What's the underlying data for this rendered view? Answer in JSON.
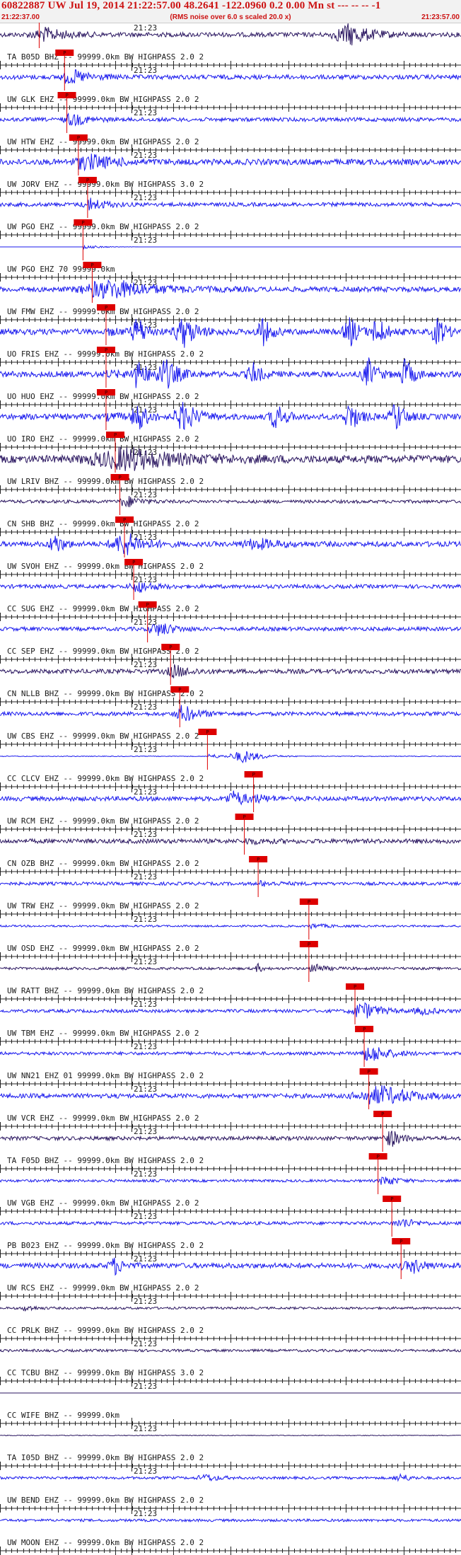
{
  "header": {
    "title": "60822887 UW Jul 19, 2014 21:22:57.00   48.2641 -122.0960  0.2 0.00 Mn st --- -- --  -1",
    "start_time": "21:22:37.00",
    "note": "(RMS noise over 6.0 s scaled 20.0 x)",
    "end_time": "21:23:57.00"
  },
  "minute_label": "21:23",
  "pick_label": "P",
  "colors": {
    "trace_blue": "#1a1aee",
    "trace_navy": "#2a1660",
    "pick_red": "#dd0000",
    "grid": "#222222"
  },
  "traces": [
    {
      "label": "TA B05D BHZ -- 99999.0km BW  HIGHPASS  2.0  2",
      "color": "navy",
      "pick": 0.085,
      "amp": 0.35,
      "bursts": [
        [
          0.1,
          0.05,
          0.7
        ],
        [
          0.76,
          0.05,
          1.6
        ]
      ]
    },
    {
      "label": "UW GLK EHZ -- 99999.0km BW  HIGHPASS  2.0  2",
      "color": "blue",
      "pick": 0.14,
      "amp": 0.35,
      "bursts": [
        [
          0.16,
          0.04,
          0.7
        ]
      ]
    },
    {
      "label": "UW HTW EHZ -- 99999.0km BW  HIGHPASS  2.0  2",
      "color": "blue",
      "pick": 0.145,
      "amp": 0.3,
      "bursts": [
        [
          0.16,
          0.03,
          0.6
        ]
      ]
    },
    {
      "label": "UW JORV EHZ -- 99999.0km BW  HIGHPASS  3.0  2",
      "color": "blue",
      "pick": 0.17,
      "amp": 0.45,
      "bursts": [
        [
          0.2,
          0.06,
          0.8
        ]
      ]
    },
    {
      "label": "UW PGO EHZ -- 99999.0km BW  HIGHPASS  2.0  2",
      "color": "blue",
      "pick": 0.19,
      "amp": 0.3,
      "bursts": [
        [
          0.2,
          0.03,
          0.6
        ]
      ]
    },
    {
      "label": "UW PGO EHZ 70 99999.0km",
      "color": "blue",
      "pick": 0.18,
      "amp": 0.0,
      "bursts": []
    },
    {
      "label": "UW FMW EHZ -- 99999.0km BW  HIGHPASS  2.0  2",
      "color": "blue",
      "pick": 0.2,
      "amp": 0.4,
      "bursts": [
        [
          0.25,
          0.1,
          1.2
        ]
      ]
    },
    {
      "label": "UO FRIS EHZ -- 99999.0km BW  HIGHPASS  2.0  2",
      "color": "blue",
      "pick": 0.23,
      "amp": 0.45,
      "bursts": [
        [
          0.3,
          0.02,
          2.2
        ],
        [
          0.4,
          0.03,
          2.2
        ],
        [
          0.57,
          0.02,
          2
        ],
        [
          0.76,
          0.02,
          2.2
        ],
        [
          0.82,
          0.02,
          2.2
        ],
        [
          0.95,
          0.02,
          2
        ]
      ]
    },
    {
      "label": "UO HUO EHZ -- 99999.0km BW  HIGHPASS  2.0  2",
      "color": "blue",
      "pick": 0.23,
      "amp": 0.45,
      "bursts": [
        [
          0.3,
          0.02,
          2.2
        ],
        [
          0.36,
          0.03,
          2.2
        ],
        [
          0.55,
          0.02,
          1.5
        ],
        [
          0.8,
          0.02,
          2.2
        ],
        [
          0.88,
          0.02,
          2.2
        ]
      ]
    },
    {
      "label": "UO IRO EHZ -- 99999.0km BW  HIGHPASS  2.0  2",
      "color": "blue",
      "pick": 0.23,
      "amp": 0.45,
      "bursts": [
        [
          0.3,
          0.02,
          2.2
        ],
        [
          0.4,
          0.03,
          2.2
        ],
        [
          0.6,
          0.02,
          2
        ],
        [
          0.76,
          0.02,
          2.2
        ],
        [
          0.86,
          0.02,
          2.2
        ]
      ]
    },
    {
      "label": "UW LRIV BHZ -- 99999.0km BW  HIGHPASS  2.0  2",
      "color": "navy",
      "pick": 0.25,
      "amp": 0.6,
      "bursts": [
        [
          0.28,
          0.12,
          1.4
        ]
      ]
    },
    {
      "label": "CN SHB BHZ -- 99999.0km BW  HIGHPASS  2.0  2",
      "color": "navy",
      "pick": 0.26,
      "amp": 0.25,
      "bursts": [
        [
          0.28,
          0.03,
          0.5
        ]
      ]
    },
    {
      "label": "UW SVOH EHZ -- 99999.0km BW  HIGHPASS  2.0  2",
      "color": "blue",
      "pick": 0.27,
      "amp": 0.4,
      "bursts": [
        [
          0.12,
          0.02,
          1.4
        ],
        [
          0.27,
          0.04,
          1.6
        ],
        [
          0.56,
          0.05,
          0.7
        ]
      ]
    },
    {
      "label": "CC SUG EHZ -- 99999.0km BW  HIGHPASS  2.0  2",
      "color": "blue",
      "pick": 0.29,
      "amp": 0.3,
      "bursts": [
        [
          0.3,
          0.03,
          0.6
        ]
      ]
    },
    {
      "label": "CC SEP EHZ -- 99999.0km BW  HIGHPASS  2.0  2",
      "color": "blue",
      "pick": 0.32,
      "amp": 0.3,
      "bursts": [
        [
          0.35,
          0.03,
          0.8
        ]
      ]
    },
    {
      "label": "CN NLLB BHZ -- 99999.0km BW  HIGHPASS  2.0  2",
      "color": "navy",
      "pick": 0.37,
      "amp": 0.35,
      "bursts": [
        [
          0.38,
          0.03,
          0.6
        ]
      ]
    },
    {
      "label": "UW CBS EHZ -- 99999.0km BW  HIGHPASS  2.0  2",
      "color": "blue",
      "pick": 0.39,
      "amp": 0.3,
      "bursts": [
        [
          0.4,
          0.03,
          1.0
        ]
      ]
    },
    {
      "label": "CC CLCV EHZ -- 99999.0km BW  HIGHPASS  2.0  2",
      "color": "blue",
      "pick": 0.45,
      "amp": 0.06,
      "bursts": [
        [
          0.53,
          0.04,
          1.0
        ]
      ]
    },
    {
      "label": "UW RCM EHZ -- 99999.0km BW  HIGHPASS  2.0  2",
      "color": "blue",
      "pick": 0.55,
      "amp": 0.35,
      "bursts": [
        [
          0.51,
          0.03,
          1.1
        ]
      ]
    },
    {
      "label": "CN OZB BHZ -- 99999.0km BW  HIGHPASS  2.0  2",
      "color": "navy",
      "pick": 0.53,
      "amp": 0.35,
      "bursts": []
    },
    {
      "label": "UW TRW EHZ -- 99999.0km BW  HIGHPASS  2.0  2",
      "color": "blue",
      "pick": 0.56,
      "amp": 0.25,
      "bursts": []
    },
    {
      "label": "UW OSD EHZ -- 99999.0km BW  HIGHPASS  2.0  2",
      "color": "blue",
      "pick": 0.67,
      "amp": 0.15,
      "bursts": []
    },
    {
      "label": "UW RATT BHZ -- 99999.0km BW  HIGHPASS  2.0  2",
      "color": "navy",
      "pick": 0.67,
      "amp": 0.2,
      "bursts": [
        [
          0.56,
          0.01,
          0.6
        ],
        [
          0.685,
          0.01,
          0.8
        ]
      ]
    },
    {
      "label": "UW TBM EHZ -- 99999.0km BW  HIGHPASS  2.0  2",
      "color": "blue",
      "pick": 0.77,
      "amp": 0.25,
      "bursts": [
        [
          0.79,
          0.04,
          1.0
        ],
        [
          0.92,
          0.03,
          0.5
        ]
      ]
    },
    {
      "label": "UW NN21 EHZ 01 99999.0km BW  HIGHPASS  2.0  2",
      "color": "blue",
      "pick": 0.79,
      "amp": 0.25,
      "bursts": [
        [
          0.81,
          0.04,
          1.0
        ]
      ]
    },
    {
      "label": "UW VCR EHZ -- 99999.0km BW  HIGHPASS  2.0  2",
      "color": "blue",
      "pick": 0.8,
      "amp": 0.35,
      "bursts": [
        [
          0.83,
          0.08,
          1.2
        ]
      ]
    },
    {
      "label": "TA F05D BHZ -- 99999.0km BW  HIGHPASS  2.0  2",
      "color": "navy",
      "pick": 0.83,
      "amp": 0.3,
      "bursts": [
        [
          0.85,
          0.02,
          1.0
        ]
      ]
    },
    {
      "label": "UW VGB EHZ -- 99999.0km BW  HIGHPASS  2.0  2",
      "color": "blue",
      "pick": 0.82,
      "amp": 0.2,
      "bursts": [
        [
          0.84,
          0.02,
          0.5
        ]
      ]
    },
    {
      "label": "PB B023 EHZ -- 99999.0km BW  HIGHPASS  2.0  2",
      "color": "blue",
      "pick": 0.85,
      "amp": 0.25,
      "bursts": [
        [
          0.88,
          0.02,
          0.5
        ]
      ]
    },
    {
      "label": "UW RCS EHZ -- 99999.0km BW  HIGHPASS  2.0  2",
      "color": "blue",
      "pick": 0.87,
      "amp": 0.4,
      "bursts": [
        [
          0.25,
          0.02,
          1.2
        ],
        [
          0.9,
          0.02,
          0.8
        ]
      ]
    },
    {
      "label": "CC PRLK BHZ -- 99999.0km BW  HIGHPASS  2.0  2",
      "color": "navy",
      "pick": null,
      "amp": 0.18,
      "bursts": [
        [
          0.06,
          0.02,
          0.4
        ]
      ]
    },
    {
      "label": "CC TCBU BHZ -- 99999.0km BW  HIGHPASS  3.0  2",
      "color": "navy",
      "pick": null,
      "amp": 0.2,
      "bursts": []
    },
    {
      "label": "CC WIFE BHZ -- 99999.0km",
      "color": "navy",
      "pick": null,
      "amp": 0.0,
      "bursts": []
    },
    {
      "label": "TA I05D BHZ -- 99999.0km BW  HIGHPASS  2.0  2",
      "color": "navy",
      "pick": null,
      "amp": 0.06,
      "bursts": []
    },
    {
      "label": "UW BEND EHZ -- 99999.0km BW  HIGHPASS  2.0  2",
      "color": "blue",
      "pick": null,
      "amp": 0.2,
      "bursts": [
        [
          0.45,
          0.03,
          0.5
        ],
        [
          0.87,
          0.02,
          0.6
        ]
      ]
    },
    {
      "label": "UW MOON EHZ -- 99999.0km BW  HIGHPASS  2.0  2",
      "color": "blue",
      "pick": null,
      "amp": 0.2,
      "bursts": []
    }
  ]
}
